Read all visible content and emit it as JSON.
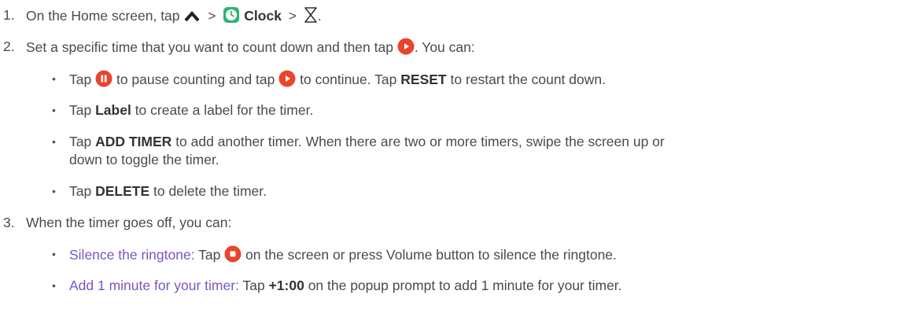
{
  "steps": [
    {
      "number": "1.",
      "parts": {
        "a": "On the Home screen, tap",
        "gt1": ">",
        "clock": "Clock",
        "gt2": ">",
        "end": "."
      }
    },
    {
      "number": "2.",
      "parts": {
        "a": "Set a specific time that you want to count down and then tap",
        "b": ". You can:"
      },
      "bullets": [
        {
          "a": "Tap",
          "b": "to pause counting and tap",
          "c": "to continue. Tap",
          "bold": "RESET",
          "d": "to restart the count down."
        },
        {
          "a": "Tap",
          "bold": "Label",
          "b": "to create a label for the timer."
        },
        {
          "a": "Tap",
          "bold": "ADD TIMER",
          "b": "to add another timer. When there are two or more timers, swipe the screen up or",
          "c": "down to toggle the timer."
        },
        {
          "a": "Tap",
          "bold": "DELETE",
          "b": "to delete the timer."
        }
      ]
    },
    {
      "number": "3.",
      "parts": {
        "a": "When the timer goes off, you can:"
      },
      "bullets": [
        {
          "link": "Silence the ringtone:",
          "a": "Tap",
          "b": "on the screen or press Volume button to silence the ringtone."
        },
        {
          "link": "Add 1 minute for your timer:",
          "a": "Tap",
          "bold": "+1:00",
          "b": "on the popup prompt to add 1 minute for your timer."
        }
      ]
    }
  ],
  "bullet_char": "•",
  "icons": {
    "up_arrow": "chevron-up-icon",
    "clock_app": "clock-app-icon",
    "hourglass": "hourglass-icon",
    "play": "play-button-icon",
    "pause": "pause-button-icon",
    "stop": "stop-button-icon"
  },
  "colors": {
    "text": "#4a4a4a",
    "link": "#7a55c6",
    "action_red": "#e8452c",
    "clock_green": "#2bb673"
  }
}
